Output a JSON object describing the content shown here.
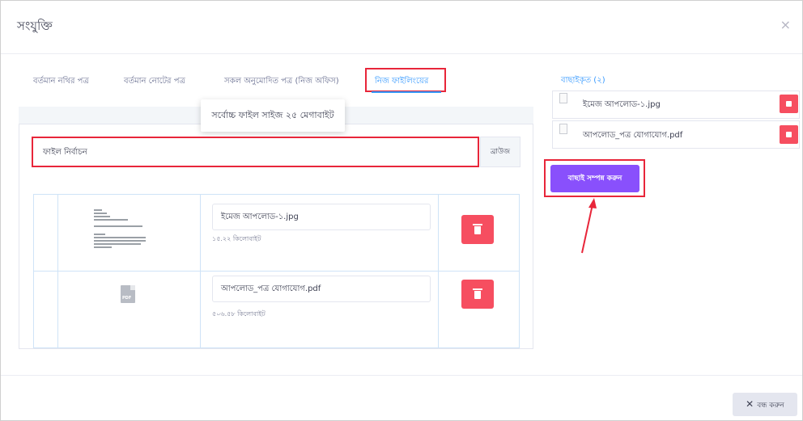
{
  "modal": {
    "title": "সংযুক্তি",
    "close_icon": "close-icon"
  },
  "tabs": [
    {
      "label": "বর্তমান নথির পত্র"
    },
    {
      "label": "বর্তমান নোটের পত্র"
    },
    {
      "label": "সকল অনুমোদিত পত্র (নিজ অফিস)"
    },
    {
      "label": "নিজ ফাইলিংয়ের",
      "active": true
    }
  ],
  "upload": {
    "tooltip": "সর্বোচ্চ ফাইল সাইজ ২৫ মেগাবাইট",
    "file_label": "ফাইল নির্বাচন",
    "browse_label": "ব্রাউজ"
  },
  "files": [
    {
      "name": "ইমেজ আপলোড-১.jpg",
      "size": "১৫.২২ কিলোবাইট",
      "thumb": "document-preview"
    },
    {
      "name": "আপলোড_পত্র যোগাযোগ.pdf",
      "size": "৫০৬.৫৮ কিলোবাইট",
      "thumb": "pdf-icon"
    }
  ],
  "selected": {
    "title": "বাছাইকৃত (২)",
    "items": [
      {
        "name": "ইমেজ আপলোড-১.jpg"
      },
      {
        "name": "আপলোড_পত্র যোগাযোগ.pdf"
      }
    ],
    "confirm_label": "বাছাই সম্পন্ন করুন"
  },
  "footer": {
    "close_label": "বন্ধ করুন"
  },
  "colors": {
    "primary": "#3699ff",
    "danger": "#f64e60",
    "purple": "#8950fc",
    "highlight": "#e8263a"
  }
}
